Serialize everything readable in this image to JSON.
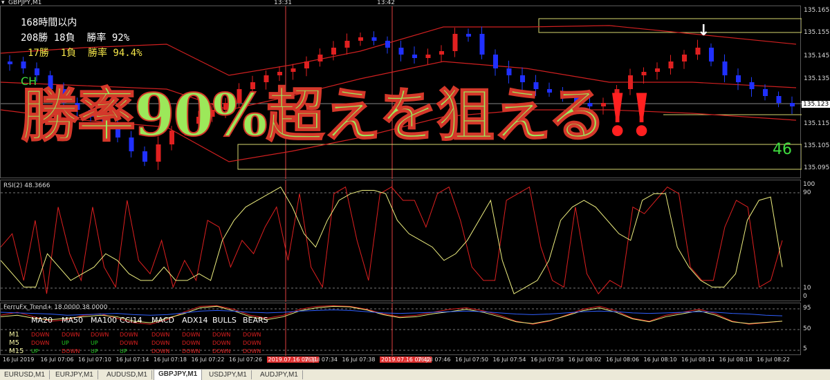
{
  "window": {
    "title": "GBPJPY,M1"
  },
  "time_markers": [
    "13:31",
    "13:42"
  ],
  "overlay": {
    "stat_title": "168時間以内",
    "stat_line1": "208勝 18負  勝率 92%",
    "stat_line2": "17勝  1負  勝率 94.4%",
    "ch_label": "CH",
    "headline": "勝率90%超えを狙える",
    "headline_bang": "!!",
    "count": "46"
  },
  "price_axis": {
    "labels": [
      "135.165",
      "135.155",
      "135.145",
      "135.135",
      "135.125",
      "135.115",
      "135.105",
      "135.095"
    ],
    "current": "135.123"
  },
  "rsi": {
    "title": "RSI(2) 48.3666",
    "levels": [
      "100",
      "90",
      "10",
      "0"
    ]
  },
  "trend": {
    "title": "FerruFx_Trend+ 18.0000 38.0000",
    "levels": [
      "95",
      "50",
      "5"
    ],
    "headers": [
      "MA20",
      "MA50",
      "MA100",
      "CCI14",
      "MACD",
      "ADX14",
      "BULLS",
      "BEARS"
    ],
    "rows": [
      {
        "label": "M1",
        "signals": [
          "DOWN",
          "DOWN",
          "DOWN",
          "DOWN",
          "DOWN",
          "DOWN",
          "DOWN",
          "DOWN"
        ]
      },
      {
        "label": "M5",
        "signals": [
          "DOWN",
          "UP",
          "UP",
          "DOWN",
          "DOWN",
          "DOWN",
          "DOWN",
          "DOWN"
        ]
      },
      {
        "label": "M15",
        "signals": [
          "UP",
          "DOWN",
          "UP",
          "UP",
          "DOWN",
          "DOWN",
          "DOWN",
          "DOWN"
        ]
      }
    ],
    "colors": {
      "up": "#22cc22",
      "down": "#e02020"
    }
  },
  "time_axis": {
    "labels": [
      "16 Jul 2019",
      "16 Jul 07:06",
      "16 Jul 07:10",
      "16 Jul 07:14",
      "16 Jul 07:18",
      "16 Jul 07:22",
      "16 Jul 07:26",
      "2019.07.16 07:31",
      "16 Jul 07:34",
      "16 Jul 07:38",
      "2019.07.16 07:42",
      "16 Jul 07:46",
      "16 Jul 07:50",
      "16 Jul 07:54",
      "16 Jul 07:58",
      "16 Jul 08:02",
      "16 Jul 08:06",
      "16 Jul 08:10",
      "16 Jul 08:14",
      "16 Jul 08:18",
      "16 Jul 08:22"
    ]
  },
  "tabs": [
    {
      "label": "EURUSD,M1"
    },
    {
      "label": "EURJPY,M1"
    },
    {
      "label": "AUDUSD,M1"
    },
    {
      "label": "GBPJPY,M1",
      "active": true
    },
    {
      "label": "USDJPY,M1"
    },
    {
      "label": "AUDJPY,M1"
    }
  ]
}
